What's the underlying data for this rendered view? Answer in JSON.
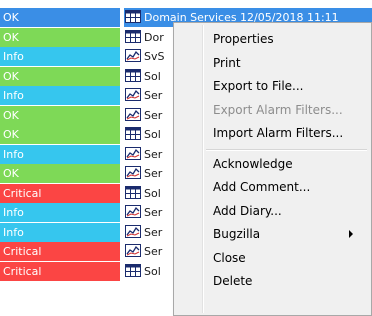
{
  "colors": {
    "ok": "#7ed957",
    "info": "#36c6ee",
    "critical": "#fb4544",
    "selected": "#3a8ee6"
  },
  "rows": [
    {
      "severity": "OK",
      "kind": "ok",
      "icon": "table-icon",
      "text": "Domain Services 12/05/2018 11:11",
      "selected": true
    },
    {
      "severity": "OK",
      "kind": "ok",
      "icon": "table-icon",
      "text": "Dor",
      "selected": false
    },
    {
      "severity": "Info",
      "kind": "info",
      "icon": "chart-icon",
      "text": "SvS",
      "selected": false
    },
    {
      "severity": "OK",
      "kind": "ok",
      "icon": "table-icon",
      "text": "Sol",
      "selected": false
    },
    {
      "severity": "Info",
      "kind": "info",
      "icon": "chart-icon",
      "text": "Ser",
      "selected": false
    },
    {
      "severity": "OK",
      "kind": "ok",
      "icon": "chart-icon",
      "text": "Ser",
      "selected": false
    },
    {
      "severity": "OK",
      "kind": "ok",
      "icon": "table-icon",
      "text": "Sol",
      "selected": false
    },
    {
      "severity": "Info",
      "kind": "info",
      "icon": "chart-icon",
      "text": "Ser",
      "selected": false
    },
    {
      "severity": "OK",
      "kind": "ok",
      "icon": "chart-icon",
      "text": "Ser",
      "selected": false
    },
    {
      "severity": "Critical",
      "kind": "critical",
      "icon": "table-icon",
      "text": "Sol",
      "selected": false
    },
    {
      "severity": "Info",
      "kind": "info",
      "icon": "chart-icon",
      "text": "Ser",
      "selected": false
    },
    {
      "severity": "Info",
      "kind": "info",
      "icon": "chart-icon",
      "text": "Ser",
      "selected": false
    },
    {
      "severity": "Critical",
      "kind": "critical",
      "icon": "chart-icon",
      "text": "Ser",
      "selected": false
    },
    {
      "severity": "Critical",
      "kind": "critical",
      "icon": "table-icon",
      "text": "Sol",
      "selected": false
    }
  ],
  "menu": {
    "items": [
      {
        "label": "Properties",
        "disabled": false,
        "submenu": false
      },
      {
        "label": "Print",
        "disabled": false,
        "submenu": false
      },
      {
        "label": "Export to File...",
        "disabled": false,
        "submenu": false
      },
      {
        "label": "Export Alarm Filters...",
        "disabled": true,
        "submenu": false
      },
      {
        "label": "Import Alarm Filters...",
        "disabled": false,
        "submenu": false
      },
      {
        "separator": true
      },
      {
        "label": "Acknowledge",
        "disabled": false,
        "submenu": false
      },
      {
        "label": "Add Comment...",
        "disabled": false,
        "submenu": false
      },
      {
        "label": "Add Diary...",
        "disabled": false,
        "submenu": false
      },
      {
        "label": "Bugzilla",
        "disabled": false,
        "submenu": true
      },
      {
        "label": "Close",
        "disabled": false,
        "submenu": false
      },
      {
        "label": "Delete",
        "disabled": false,
        "submenu": false
      }
    ]
  }
}
